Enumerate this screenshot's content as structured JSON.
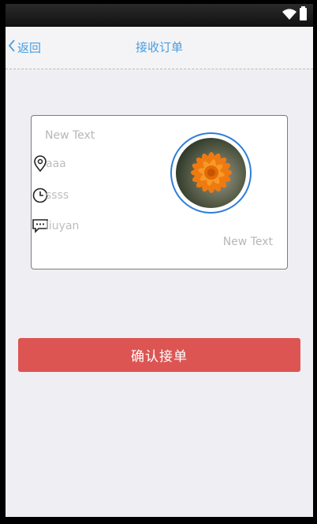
{
  "header": {
    "back_label": "返回",
    "title": "接收订单"
  },
  "order_card": {
    "title_text": "New Text",
    "address_value": "aaa",
    "time_value": "ssss",
    "message_value": "liuyan",
    "footer_text": "New Text",
    "avatar_border_color": "#2f7ed8"
  },
  "actions": {
    "confirm_label": "确认接单",
    "confirm_color": "#dc5553"
  },
  "colors": {
    "accent": "#4a9de0",
    "background": "#efeff3"
  },
  "icons": [
    "chevron-left-icon",
    "location-pin-icon",
    "clock-icon",
    "chat-bubble-icon",
    "wifi-icon",
    "battery-icon"
  ]
}
